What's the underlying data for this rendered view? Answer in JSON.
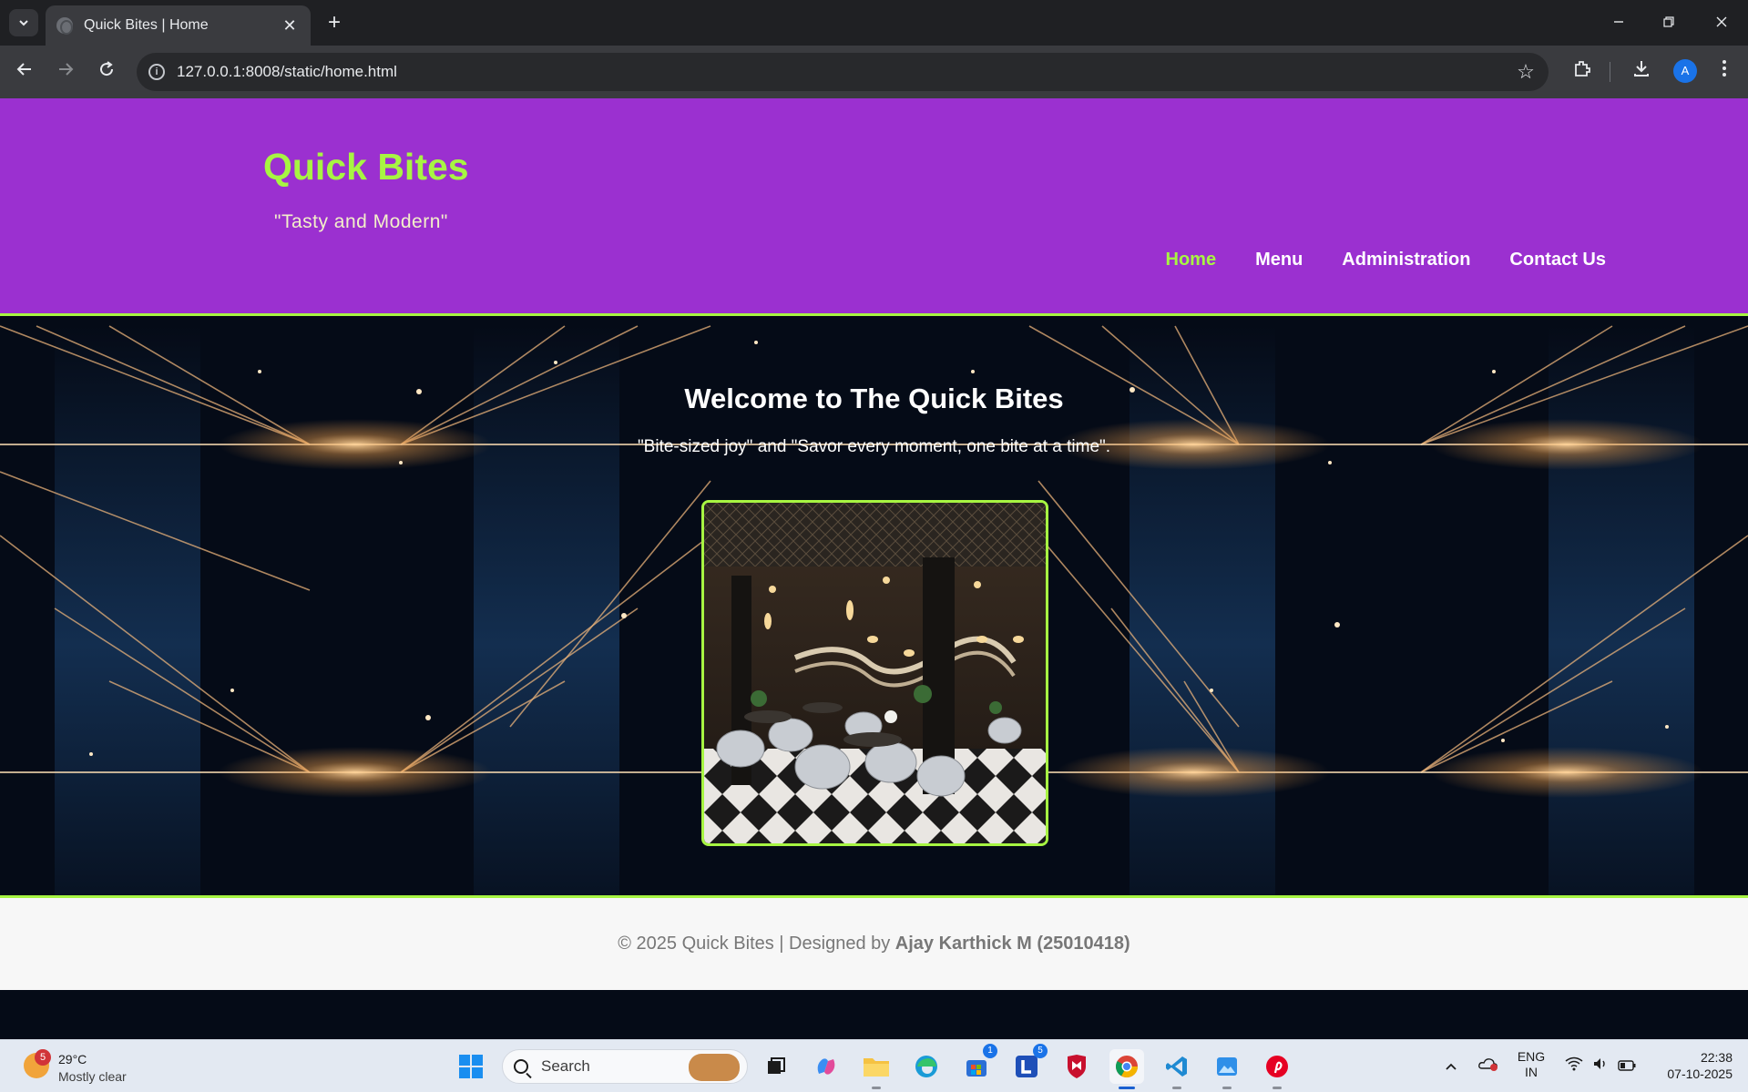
{
  "browser": {
    "tab_title": "Quick Bites | Home",
    "tab_close": "✕",
    "new_tab": "+",
    "url": "127.0.0.1:8008/static/home.html",
    "avatar_letter": "A"
  },
  "site": {
    "brand": "Quick Bites",
    "tagline": "\"Tasty and Modern\"",
    "nav": [
      {
        "label": "Home",
        "active": true
      },
      {
        "label": "Menu",
        "active": false
      },
      {
        "label": "Administration",
        "active": false
      },
      {
        "label": "Contact Us",
        "active": false
      }
    ],
    "welcome": "Welcome to The Quick Bites",
    "slogan": "\"Bite-sized joy\" and \"Savor every moment, one bite at a time\".",
    "footer": {
      "prefix": "© 2025 Quick Bites | Designed by ",
      "author": "Ajay Karthick M (25010418)"
    }
  },
  "taskbar": {
    "weather_temp": "29°C",
    "weather_condition": "Mostly clear",
    "weather_badge": "5",
    "search_label": "Search",
    "store_badge": "1",
    "lapp_badge": "5",
    "language": "ENG",
    "region": "IN",
    "time": "22:38",
    "date": "07-10-2025"
  },
  "colors": {
    "header_bg": "#9b30d0",
    "accent_green": "#a7f542",
    "footer_bg": "#f7f7f7"
  }
}
